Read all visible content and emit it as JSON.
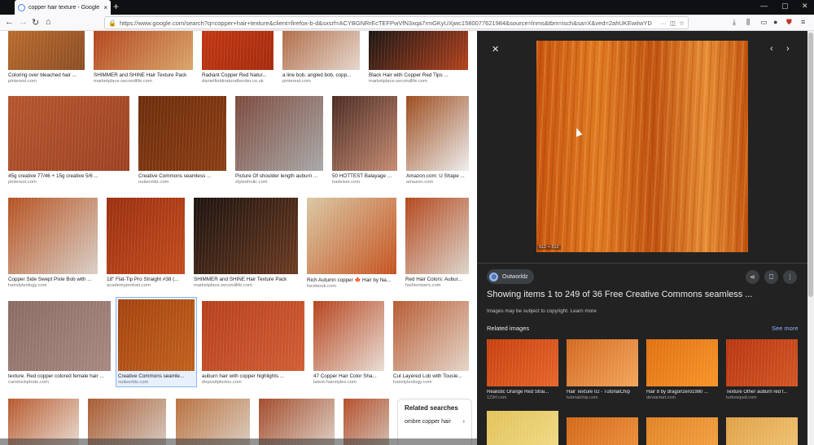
{
  "browser": {
    "tab_title": "copper hair texture - Google Se",
    "tab_close": "×",
    "new_tab": "+",
    "url": "https://www.google.com/search?q=copper+hair+texture&client=firefox-b-d&sxsrf=ACYBGNRrEcTEFPwVfN3xqa7rmGKyUXjwc1580077621984&source=lnms&tbm=isch&sa=X&ved=2ahUKEwiIwYD",
    "win_minimize": "—",
    "win_restore": "▢",
    "win_close": "✕"
  },
  "results": [
    {
      "caption": "Coloring over bleached hair ...",
      "source": "pinterest.com",
      "colors": [
        "#b96a2c",
        "#8a4c23"
      ]
    },
    {
      "caption": "SHIMMER and SHINE Hair Texture Pack",
      "source": "marketplace.secondlife.com",
      "colors": [
        "#b3451c",
        "#d9a56a"
      ]
    },
    {
      "caption": "Radiant Copper Red Natur...",
      "source": "danielfieldnaturalborder.co.uk",
      "colors": [
        "#c03612",
        "#a52a0b"
      ]
    },
    {
      "caption": "a line bob, angled bob, copp...",
      "source": "pinterest.com",
      "colors": [
        "#b06c48",
        "#e5d7cc"
      ]
    },
    {
      "caption": "Black Hair with Copper Red Tips ...",
      "source": "marketplace.secondlife.com",
      "colors": [
        "#1b1512",
        "#b2401c"
      ]
    },
    {
      "caption": "45g creative 77/46 + 15g creative 5/6 ...",
      "source": "pinterest.com",
      "colors": [
        "#b4552e",
        "#9c4121"
      ]
    },
    {
      "caption": "Creative Commons seamless ...",
      "source": "outworldz.com",
      "colors": [
        "#6d2c0b",
        "#8a3d12"
      ]
    },
    {
      "caption": "Picture Of shoulder length auburn ...",
      "source": "styleoholic.com",
      "colors": [
        "#7c4a3c",
        "#a8a8a8"
      ]
    },
    {
      "caption": "50 HOTTEST Balayage ...",
      "source": "hadviser.com",
      "colors": [
        "#4b2a22",
        "#c58b71"
      ]
    },
    {
      "caption": "Amazon.com: U Shape ...",
      "source": "amazon.com",
      "colors": [
        "#9b4b1c",
        "#eeeeee"
      ]
    },
    {
      "caption": "Copper Side Swept Pixie Bob with ...",
      "source": "hairstyleology.com",
      "colors": [
        "#b5511f",
        "#d9cfc7"
      ]
    },
    {
      "caption": "18\" Flat-Tip Pro Straight #38 (...",
      "source": "academyprohair.com",
      "colors": [
        "#9b2f0f",
        "#c24a1c"
      ]
    },
    {
      "caption": "SHIMMER and SHINE Hair Texture Pack",
      "source": "marketplace.secondlife.com",
      "colors": [
        "#1c120e",
        "#6b3a20"
      ]
    },
    {
      "caption": "Rich Autumn copper 🍁 Hair by Na...",
      "source": "facebook.com",
      "colors": [
        "#d9c7a3",
        "#c5521f"
      ]
    },
    {
      "caption": "Red Hair Colors: Aubur...",
      "source": "fashionisers.com",
      "colors": [
        "#b3461b",
        "#dcd4cb"
      ]
    },
    {
      "caption": "texture. Red copper colored female hair ...",
      "source": "canstockphoto.com",
      "colors": [
        "#8a6a63",
        "#a88781"
      ]
    },
    {
      "caption": "Creative Commons seamle...",
      "source": "outworldz.com",
      "colors": [
        "#a4420e",
        "#c0601c"
      ]
    },
    {
      "caption": "auburn hair with copper highlights ...",
      "source": "depositphotos.com",
      "colors": [
        "#b63f1c",
        "#d15c34"
      ]
    },
    {
      "caption": "47 Copper Hair Color Sha...",
      "source": "latest-hairstyles.com",
      "colors": [
        "#b5421b",
        "#e8ddd4"
      ]
    },
    {
      "caption": "Cut Layered Lob with Tousle...",
      "source": "hairstyleology.com",
      "colors": [
        "#b65a32",
        "#e4d5c8"
      ]
    },
    {
      "caption": "",
      "source": "",
      "colors": [
        "#b7582c",
        "#ece5dd"
      ]
    },
    {
      "caption": "",
      "source": "",
      "colors": [
        "#a8592f",
        "#d9d1c9"
      ]
    },
    {
      "caption": "",
      "source": "",
      "colors": [
        "#b9703d",
        "#dcd3c8"
      ]
    },
    {
      "caption": "",
      "source": "",
      "colors": [
        "#a24a2a",
        "#e1d7cd"
      ]
    },
    {
      "caption": "",
      "source": "",
      "colors": [
        "#b34e2a",
        "#d4c6ba"
      ]
    }
  ],
  "related_searches": {
    "title": "Related searches",
    "chip": "ombre copper hair",
    "chevron": "›"
  },
  "panel": {
    "close": "✕",
    "prev": "‹",
    "next": "›",
    "dimensions": "512 × 512",
    "site": "Outworldz",
    "title": "Showing items 1 to 249 of 36 Free Creative Commons seamless ...",
    "copyright": "Images may be subject to copyright.",
    "learn_more": "Learn more",
    "related_heading": "Related images",
    "see_more": "See more",
    "related": [
      {
        "title": "Realistic Orange Red Strai...",
        "source": "123rf.com",
        "colors": [
          "#c7400d",
          "#e5642a"
        ]
      },
      {
        "title": "Hair Texture 02 - TutorialChip",
        "source": "tutorialchip.com",
        "colors": [
          "#d2691f",
          "#f3a55a"
        ]
      },
      {
        "title": "Hair 8 by dragonzero1980 ...",
        "source": "deviantart.com",
        "colors": [
          "#e0700f",
          "#f79428"
        ]
      },
      {
        "title": "Texture Other auburn red f...",
        "source": "turbosquid.com",
        "colors": [
          "#b8360f",
          "#d25423"
        ]
      },
      {
        "title": "",
        "source": "",
        "colors": [
          "#e2c25a",
          "#f1db87"
        ]
      },
      {
        "title": "",
        "source": "",
        "colors": [
          "#d16817",
          "#f09440"
        ]
      },
      {
        "title": "",
        "source": "",
        "colors": [
          "#e08324",
          "#f6a445"
        ]
      },
      {
        "title": "",
        "source": "",
        "colors": [
          "#e0a145",
          "#f1c679"
        ]
      }
    ]
  }
}
